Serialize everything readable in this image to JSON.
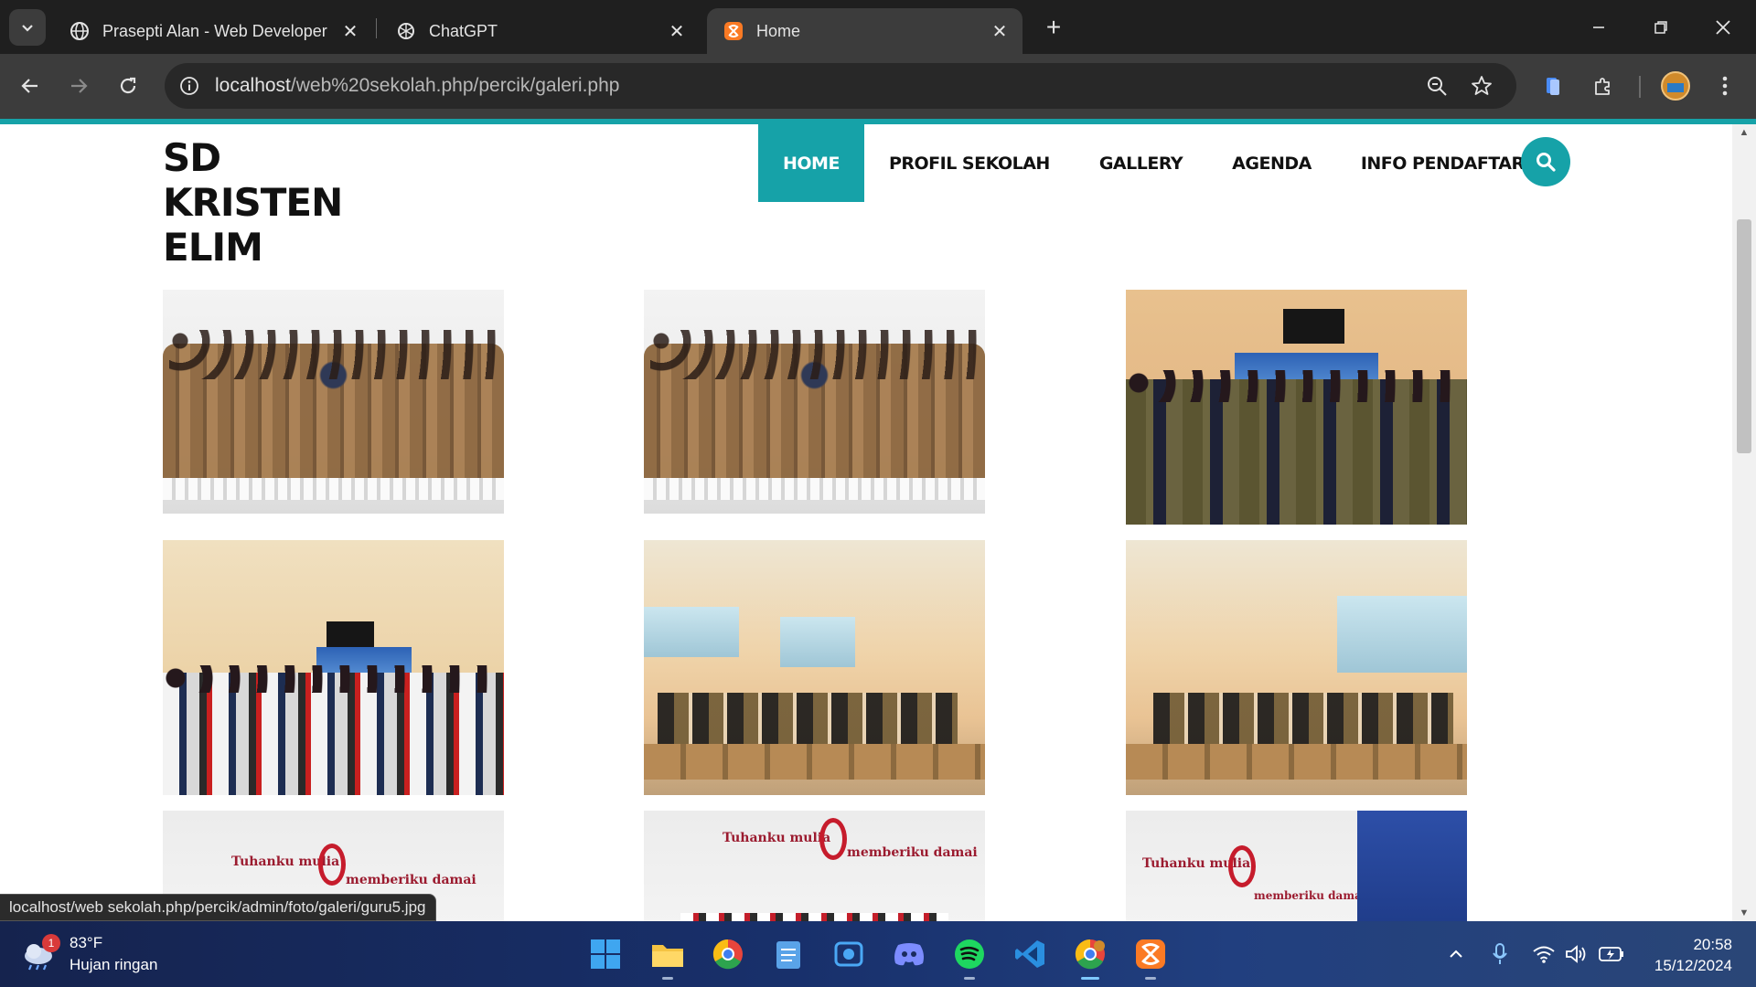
{
  "browser": {
    "tabs": [
      {
        "title": "Prasepti Alan - Web Developer",
        "icon": "globe-icon"
      },
      {
        "title": "ChatGPT",
        "icon": "chatgpt-icon"
      },
      {
        "title": "Home",
        "icon": "xampp-icon",
        "active": true
      }
    ],
    "url": {
      "host": "localhost",
      "path": "/web%20sekolah.php/percik/galeri.php"
    },
    "status_url": "localhost/web sekolah.php/percik/admin/foto/galeri/guru5.jpg"
  },
  "site": {
    "brand_lines": [
      "SD",
      "KRISTEN",
      "ELIM"
    ],
    "nav": [
      "HOME",
      "PROFIL SEKOLAH",
      "GALLERY",
      "AGENDA",
      "INFO PENDAFTARAN"
    ],
    "nav_active": "HOME",
    "accent_color": "#16a2a8"
  },
  "gallery": {
    "banner_text": {
      "line_a": "Tuhanku mulia",
      "line_b": "memberiku damai"
    }
  },
  "taskbar": {
    "weather": {
      "temp": "83°F",
      "desc": "Hujan ringan",
      "badge": "1"
    },
    "apps": [
      "windows-start",
      "file-explorer",
      "chrome",
      "notepad",
      "snipping-tool",
      "discord",
      "spotify",
      "vscode",
      "chrome-profile",
      "xampp"
    ],
    "clock": {
      "time": "20:58",
      "date": "15/12/2024"
    }
  }
}
